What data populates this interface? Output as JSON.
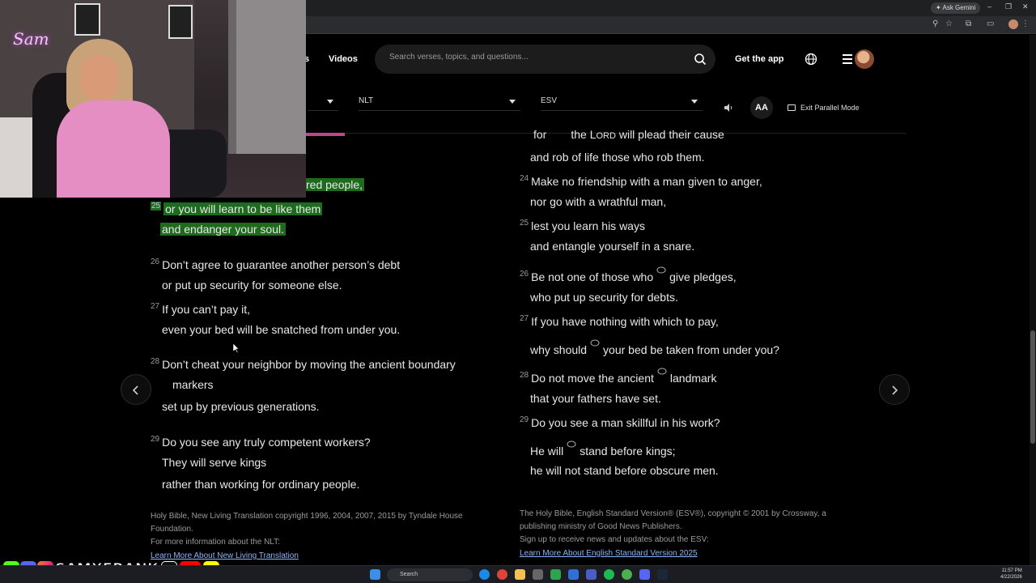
{
  "browser": {
    "gemini_label": "Ask Gemini"
  },
  "nav": {
    "s_fragment": "s",
    "videos": "Videos",
    "search_placeholder": "Search verses, topics, and questions...",
    "get_app": "Get the app"
  },
  "toolbar": {
    "translation_left": "NLT",
    "translation_right": "ESV",
    "text_size": "AA",
    "exit_parallel": "Exit Parallel Mode"
  },
  "nlt": {
    "line_24_tail": "red people,",
    "v25": {
      "num": "25",
      "l1": "or you will learn to be like them",
      "l2": "and endanger your soul."
    },
    "v26": {
      "num": "26",
      "l1": "Don’t agree to guarantee another person’s debt",
      "l2": "or put up security for someone else."
    },
    "v27": {
      "num": "27",
      "l1": "If you can’t pay it,",
      "l2": "even your bed will be snatched from under you."
    },
    "v28": {
      "num": "28",
      "l1": "Don’t cheat your neighbor by moving the ancient boundary",
      "l1b": "markers",
      "l2": "set up by previous generations."
    },
    "v29": {
      "num": "29",
      "l1": "Do you see any truly competent workers?",
      "l2": "They will serve kings",
      "l3": "rather than working for ordinary people."
    },
    "copyright_1": "Holy Bible, New Living Translation copyright 1996, 2004, 2007, 2015 by Tyndale House",
    "copyright_2": "Foundation.",
    "more_info": "For more information about the NLT:",
    "learn_more": "Learn More About New Living Translation"
  },
  "esv": {
    "v23": {
      "l1a": "for",
      "l1b": "the",
      "lord_l": "L",
      "lord_rest": "ORD",
      "l1c": "will plead their cause",
      "l2": "and rob of life those who rob them."
    },
    "v24": {
      "num": "24",
      "l1": "Make no friendship with a man given to anger,",
      "l2": "nor go with a wrathful man,"
    },
    "v25": {
      "num": "25",
      "l1": "lest you learn his ways",
      "l2": "and entangle yourself in a snare."
    },
    "v26": {
      "num": "26",
      "l1a": "Be not one of those who",
      "l1b": "give pledges,",
      "l2": "who put up security for debts."
    },
    "v27": {
      "num": "27",
      "l1": "If you have nothing with which to pay,",
      "l2a": "why should",
      "l2b": "your bed be taken from under you?"
    },
    "v28": {
      "num": "28",
      "l1a": "Do not move the ancient",
      "l1b": "landmark",
      "l2": "that your fathers have set."
    },
    "v29": {
      "num": "29",
      "l1": "Do you see a man skillful in his work?",
      "l2a": "He will",
      "l2b": "stand before kings;",
      "l3": "he will not stand before obscure men."
    },
    "copyright_1": "The Holy Bible, English Standard Version® (ESV®), copyright © 2001 by Crossway, a",
    "copyright_2": "publishing ministry of Good News Publishers.",
    "signup": "Sign up to receive news and updates about the ESV:",
    "learn_more": "Learn More About English Standard Version 2025"
  },
  "overlay": {
    "cam_name": "Sam",
    "handle": "SAMXFRANK"
  },
  "taskbar": {
    "search": "Search",
    "time": "11:57 PM",
    "date": "4/22/2026"
  },
  "colors": {
    "highlight": "#1e6a1e",
    "accent_pink": "#c2448a",
    "link": "#8ab4f8"
  }
}
